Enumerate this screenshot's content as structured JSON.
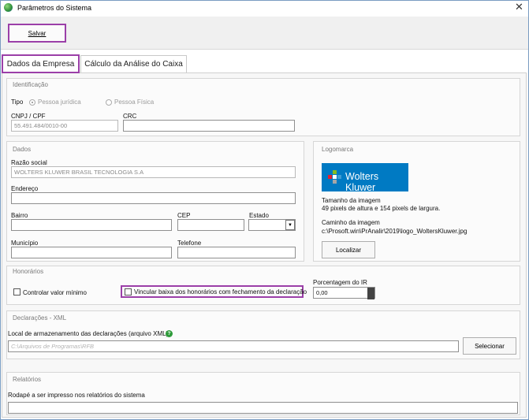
{
  "window": {
    "title": "Parâmetros do Sistema",
    "close_glyph": "✕"
  },
  "toolbar": {
    "save_label": "Salvar"
  },
  "tabs": [
    {
      "label": "Dados da Empresa",
      "active": true
    },
    {
      "label": "Cálculo da Análise do Caixa",
      "active": false
    }
  ],
  "identificacao": {
    "title": "Identificação",
    "tipo_label": "Tipo",
    "options": [
      "Pessoa jurídica",
      "Pessoa Física"
    ],
    "selected": "Pessoa jurídica",
    "cnpj_label": "CNPJ / CPF",
    "cnpj_value": "55.491.484/0010-00",
    "crc_label": "CRC",
    "crc_value": ""
  },
  "dados": {
    "title": "Dados",
    "razao_label": "Razão social",
    "razao_value": "WOLTERS KLUWER BRASIL TECNOLOGIA S.A",
    "endereco_label": "Endereço",
    "bairro_label": "Bairro",
    "cep_label": "CEP",
    "estado_label": "Estado",
    "municipio_label": "Município",
    "telefone_label": "Telefone"
  },
  "logomarca": {
    "title": "Logomarca",
    "logo_text": "Wolters Kluwer",
    "size_title": "Tamanho da imagem",
    "size_desc": "49 pixels de altura e 154 pixels de largura.",
    "path_title": "Caminho da imagem",
    "path_value": "c:\\Prosoft.win\\PrAnalir\\2019\\logo_WoltersKluwer.jpg",
    "localizar_label": "Localizar"
  },
  "honorarios": {
    "title": "Honorários",
    "controlar_label": "Controlar valor mínimo",
    "vincular_label": "Vincular baixa dos honorários com fechamento da declaração",
    "porcentagem_label": "Porcentagem do IR",
    "porcentagem_value": "0,00"
  },
  "declaracoes": {
    "title": "Declarações - XML",
    "local_label": "Local de armazenamento das declarações (arquivo XML)",
    "help_glyph": "?",
    "path_placeholder": "C:\\Arquivos de Programas\\RFB",
    "selecionar_label": "Selecionar"
  },
  "relatorios": {
    "title": "Relatórios",
    "rodape_label": "Rodapé a ser impresso nos relatórios do sistema",
    "rodape_value": ""
  },
  "colors": {
    "accent": "#9b3fa8",
    "logo_bg": "#007ac3",
    "help": "#2e9b3a"
  }
}
